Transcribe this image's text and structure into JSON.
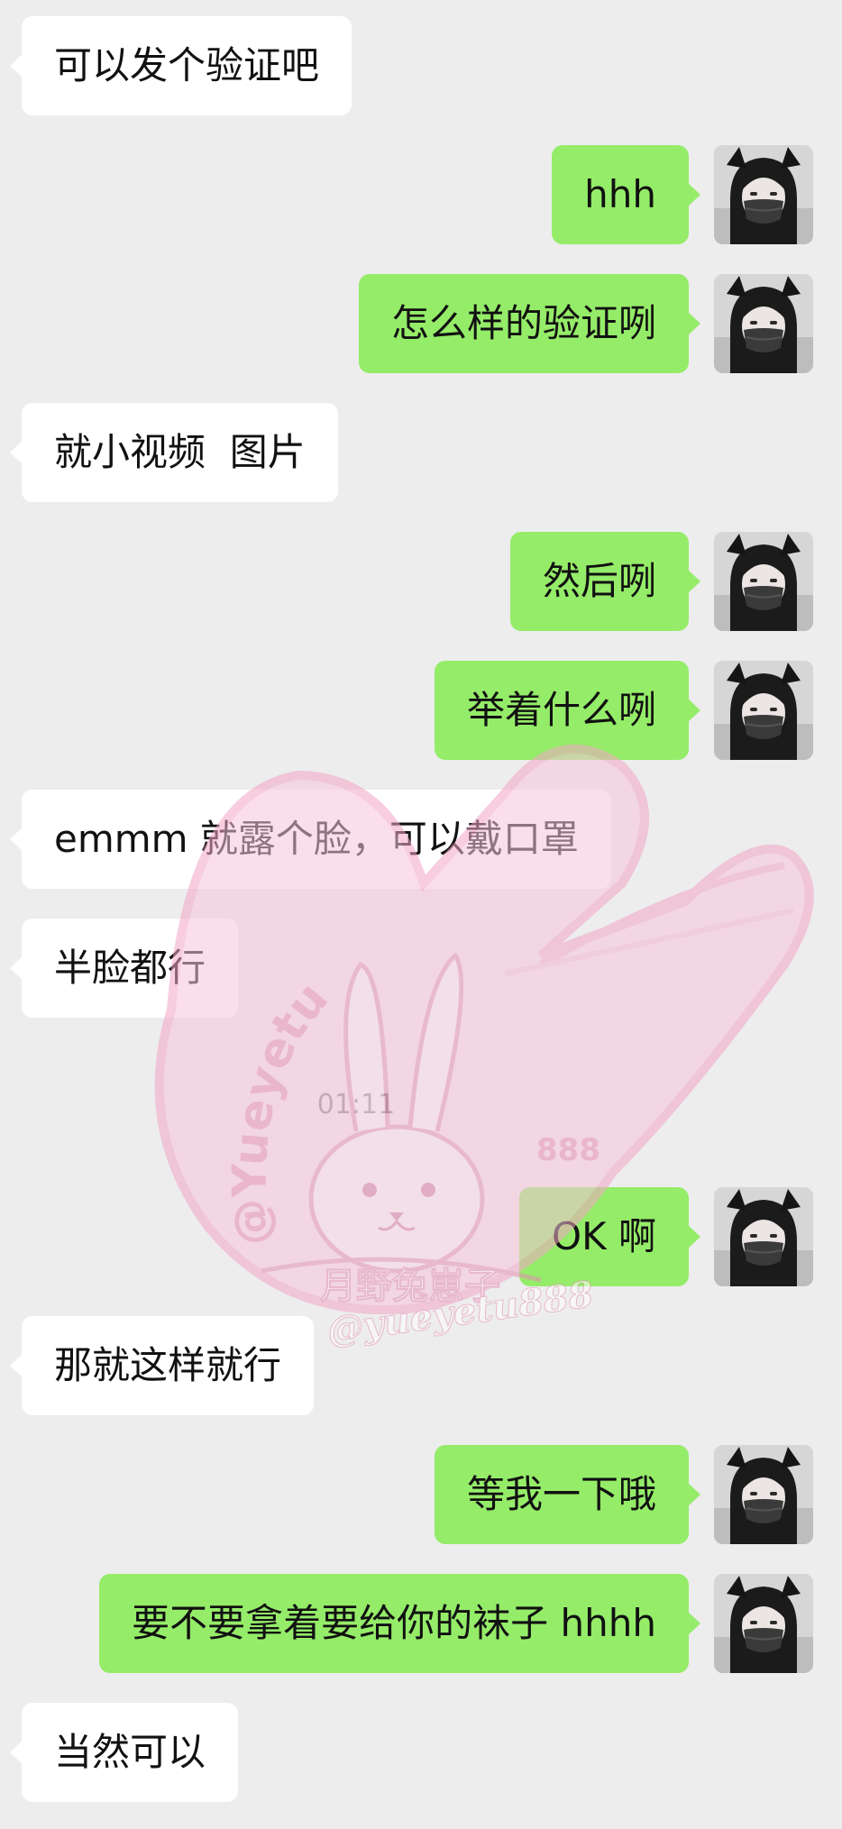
{
  "chat": {
    "messages": [
      {
        "side": "in",
        "text": "可以发个验证吧"
      },
      {
        "side": "out",
        "text": "hhh"
      },
      {
        "side": "out",
        "text": "怎么样的验证咧"
      },
      {
        "side": "in",
        "text": "就小视频  图片"
      },
      {
        "side": "out",
        "text": "然后咧"
      },
      {
        "side": "out",
        "text": "举着什么咧"
      },
      {
        "side": "in",
        "text": "emmm 就露个脸，可以戴口罩"
      },
      {
        "side": "in",
        "text": "半脸都行"
      },
      {
        "side": "out",
        "text": "OK 啊"
      },
      {
        "side": "in",
        "text": "那就这样就行"
      },
      {
        "side": "out",
        "text": "等我一下哦"
      },
      {
        "side": "out",
        "text": "要不要拿着要给你的袜子 hhhh"
      },
      {
        "side": "in",
        "text": "当然可以"
      }
    ],
    "timestamp": "01:11"
  },
  "watermark": {
    "handle_arc": "@Yueyetu",
    "number": "888",
    "cn_name": "月野兔崽子",
    "script_handle": "@yueyetu888",
    "color": "#f2a6c6"
  },
  "colors": {
    "background": "#ededed",
    "incoming_bubble": "#ffffff",
    "outgoing_bubble": "#95ec69",
    "timestamp": "#8a8a8a"
  },
  "icons": {
    "avatar": "avatar-icon"
  }
}
